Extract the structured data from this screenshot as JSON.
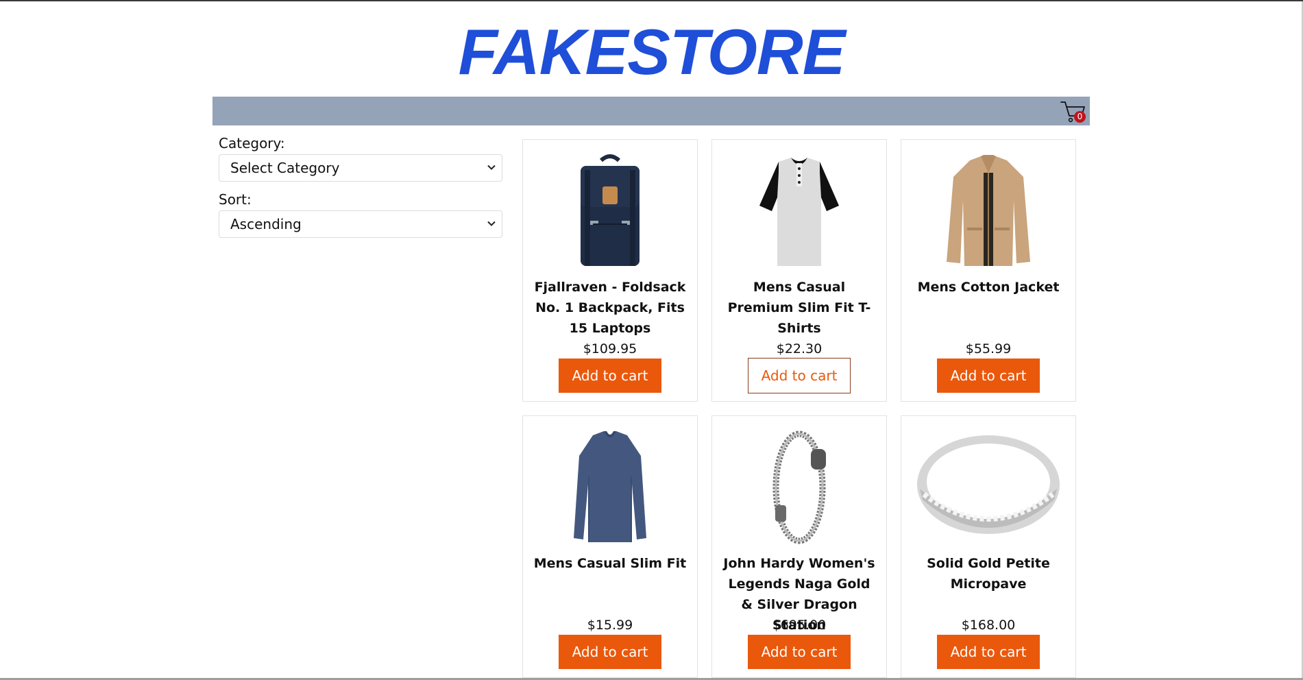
{
  "header": {
    "brand": "FAKESTORE"
  },
  "cart": {
    "count": "0",
    "icon": "cart-icon"
  },
  "filters": {
    "category_label": "Category:",
    "category_value": "Select Category",
    "sort_label": "Sort:",
    "sort_value": "Ascending"
  },
  "colors": {
    "brand": "#1f4fd8",
    "navbar": "#94a3b8",
    "accent": "#ea580c",
    "badge": "#c0141d"
  },
  "products": [
    {
      "title": "Fjallraven - Foldsack No. 1 Backpack, Fits 15 Laptops",
      "price": "$109.95",
      "button": "Add to cart",
      "image": "backpack-image"
    },
    {
      "title": "Mens Casual Premium Slim Fit T-Shirts",
      "price": "$22.30",
      "button": "Add to cart",
      "image": "tshirt-image"
    },
    {
      "title": "Mens Cotton Jacket",
      "price": "$55.99",
      "button": "Add to cart",
      "image": "jacket-image"
    },
    {
      "title": "Mens Casual Slim Fit",
      "price": "$15.99",
      "button": "Add to cart",
      "image": "longsleeve-image"
    },
    {
      "title": "John Hardy Women's Legends Naga Gold & Silver Dragon Station",
      "price": "$695.00",
      "button": "Add to cart",
      "image": "bracelet-image"
    },
    {
      "title": "Solid Gold Petite Micropave",
      "price": "$168.00",
      "button": "Add to cart",
      "image": "ring-image"
    }
  ]
}
